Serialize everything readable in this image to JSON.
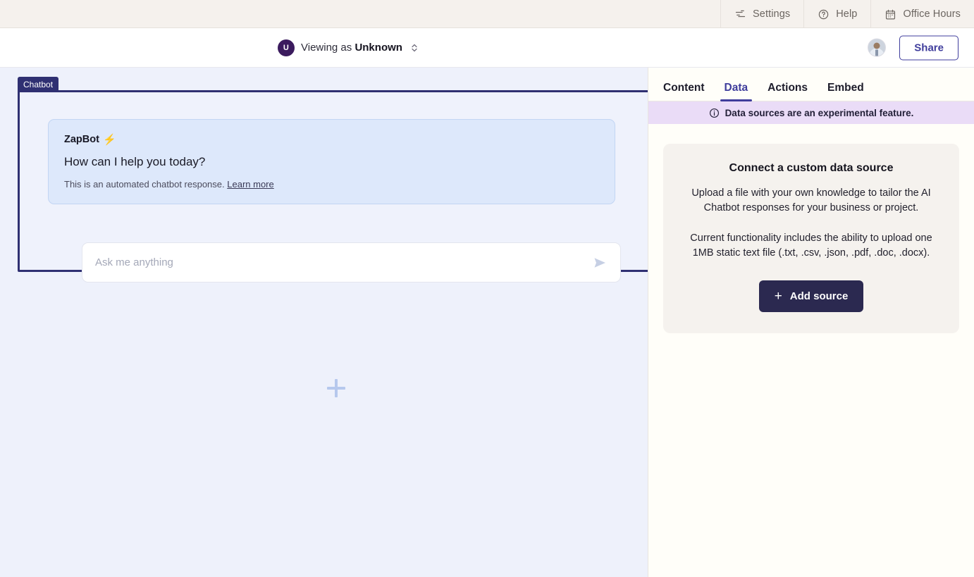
{
  "topbar": {
    "items": [
      {
        "label": "Settings",
        "icon": "sliders-icon"
      },
      {
        "label": "Help",
        "icon": "question-circle-icon"
      },
      {
        "label": "Office Hours",
        "icon": "calendar-icon"
      }
    ]
  },
  "subbar": {
    "avatar_initial": "U",
    "viewing_prefix": "Viewing as ",
    "viewing_value": "Unknown",
    "share_label": "Share"
  },
  "canvas": {
    "block_tag": "Chatbot",
    "bubble": {
      "title": "ZapBot",
      "title_emoji": "⚡",
      "question": "How can I help you today?",
      "footnote": "This is an automated chatbot response. ",
      "footnote_link": "Learn more"
    },
    "composer": {
      "placeholder": "Ask me anything",
      "value": "",
      "send_icon": "send-paper-plane-icon"
    },
    "add_block_icon": "plus-icon"
  },
  "panel": {
    "tabs": [
      {
        "label": "Content",
        "active": false
      },
      {
        "label": "Data",
        "active": true
      },
      {
        "label": "Actions",
        "active": false
      },
      {
        "label": "Embed",
        "active": false
      }
    ],
    "notice": {
      "icon": "info-circle-icon",
      "text": "Data sources are an experimental feature."
    },
    "card": {
      "title": "Connect a custom data source",
      "paragraph_1": "Upload a file with your own knowledge to tailor the AI Chatbot responses for your business or project.",
      "paragraph_2": "Current functionality includes the ability to upload one 1MB static text file (.txt, .csv, .json, .pdf, .doc, .docx).",
      "button_label": "Add source",
      "button_icon": "plus-icon"
    }
  },
  "colors": {
    "accent_indigo": "#3f3d9c",
    "dark_navy": "#2b2950",
    "canvas_bg": "#eef1fb",
    "panel_bg": "#fffef9",
    "notice_bg": "#eadcf7",
    "bubble_bg": "#dde8fb",
    "topbar_bg": "#f5f1ed"
  }
}
